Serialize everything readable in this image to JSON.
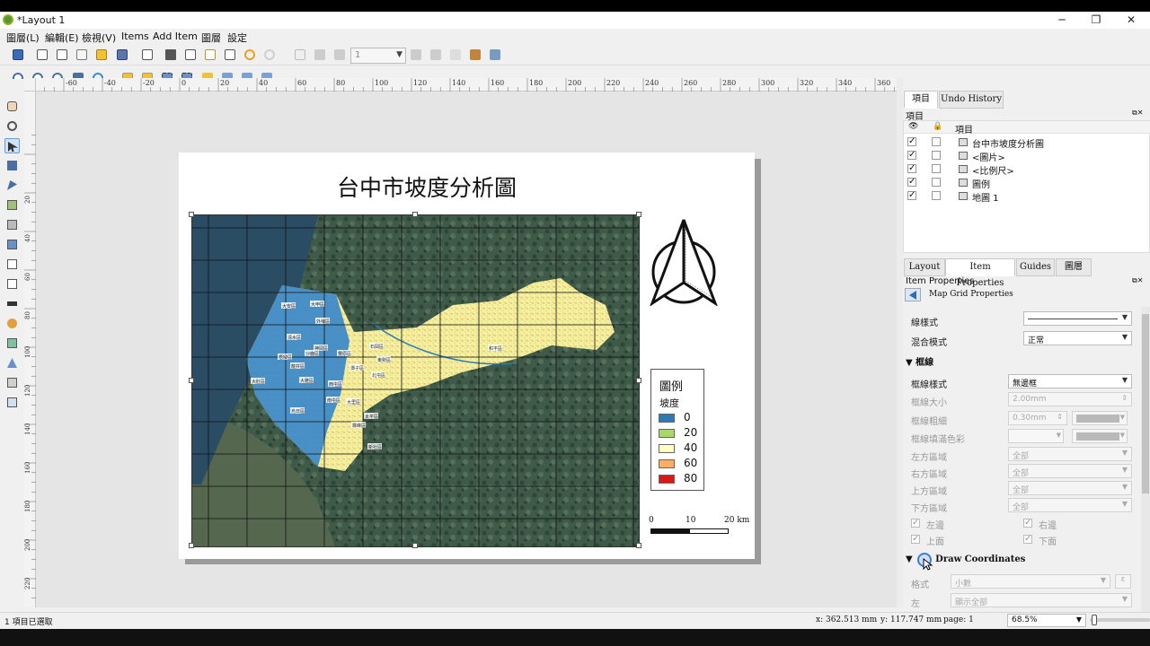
{
  "window": {
    "title": "*Layout 1",
    "minimize": "─",
    "maximize": "❐",
    "close": "✕"
  },
  "menubar": [
    "圖層(L)",
    "編輯(E)",
    "檢視(V)",
    "Items",
    "Add Item",
    "圖層",
    "設定"
  ],
  "toolbar": {
    "page_value": "1"
  },
  "layout": {
    "title": "台中市坡度分析圖",
    "legend": {
      "title": "圖例",
      "subtitle": "坡度",
      "items": [
        {
          "label": "0",
          "color": "#2c7bb6"
        },
        {
          "label": "20",
          "color": "#a6d96a"
        },
        {
          "label": "40",
          "color": "#ffffbf"
        },
        {
          "label": "60",
          "color": "#fdae61"
        },
        {
          "label": "80",
          "color": "#d7191c"
        }
      ]
    },
    "scalebar": {
      "labels": [
        "0",
        "10",
        "20 km"
      ]
    },
    "map_labels": [
      "大安區",
      "大甲區",
      "外埔區",
      "清水區",
      "梧棲區",
      "沙鹿區",
      "龍井區",
      "大肚區",
      "神岡區",
      "豐原區",
      "潭子區",
      "大雅區",
      "西屯區",
      "北屯區",
      "南屯區",
      "烏日區",
      "大里區",
      "霧峰區",
      "太平區",
      "東勢區",
      "和平區",
      "石岡區",
      "新社區"
    ]
  },
  "ruler_top": [
    "-60",
    "-40",
    "-20",
    "0",
    "20",
    "40",
    "60",
    "80",
    "100",
    "120",
    "140",
    "160",
    "180",
    "200",
    "220",
    "240",
    "260",
    "280",
    "300",
    "320",
    "340",
    "360"
  ],
  "ruler_left": [
    "20",
    "40",
    "60",
    "80",
    "100",
    "120",
    "140",
    "160",
    "180",
    "200",
    "220",
    "240",
    "260"
  ],
  "items_panel": {
    "tabs": [
      "項目",
      "Undo History"
    ],
    "heading": "項目",
    "column": "項目",
    "rows": [
      {
        "name": "台中市坡度分析圖",
        "visible": true
      },
      {
        "name": "<圖片>",
        "visible": true
      },
      {
        "name": "<比例尺>",
        "visible": true
      },
      {
        "name": "圖例",
        "visible": true
      },
      {
        "name": "地圖 1",
        "visible": true
      }
    ]
  },
  "props_panel": {
    "tabs": [
      "Layout",
      "Item Properties",
      "Guides",
      "圖層"
    ],
    "heading": "Item Properties",
    "breadcrumb": "Map Grid Properties",
    "line_style_label": "線樣式",
    "blend_label": "混合模式",
    "blend_value": "正常",
    "frame_section": "框線",
    "frame_style_label": "框線樣式",
    "frame_style_value": "無邊框",
    "frame_size_label": "框線大小",
    "frame_size_value": "2.00mm",
    "frame_thick_label": "框線粗細",
    "frame_thick_value": "0.30mm",
    "frame_fill_label": "框線填滿色彩",
    "left_div_label": "左方區域",
    "right_div_label": "右方區域",
    "top_div_label": "上方區域",
    "bottom_div_label": "下方區域",
    "div_value": "全部",
    "cb_left": "左邊",
    "cb_right": "右邊",
    "cb_top": "上面",
    "cb_bottom": "下面",
    "coords_section": "Draw Coordinates",
    "format_label": "格式",
    "format_value": "小數",
    "left_label": "左",
    "left_value": "顯示全部"
  },
  "statusbar": {
    "left": "1 項目已選取",
    "x": "x: 362.513 mm",
    "y": "y: 117.747 mm",
    "page": "page: 1",
    "zoom": "68.5%"
  }
}
